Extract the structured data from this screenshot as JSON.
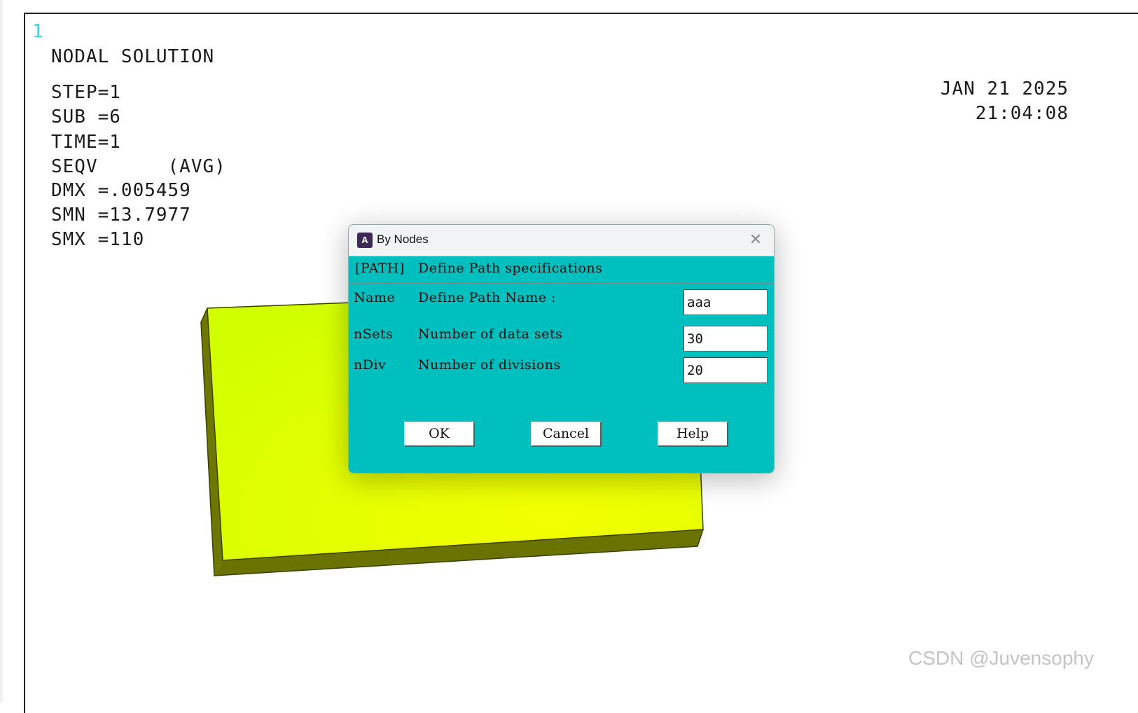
{
  "graphics": {
    "window_number": "1",
    "title": "NODAL SOLUTION",
    "info_lines": [
      "STEP=1",
      "SUB =6",
      "TIME=1",
      "SEQV      (AVG)",
      "DMX =.005459",
      "SMN =13.7977",
      "SMX =110"
    ],
    "date": "JAN 21 2025",
    "time": "21:04:08",
    "plate_color": "#dcff00",
    "plate_edge_color": "#5c6400"
  },
  "dialog": {
    "title": "By Nodes",
    "header_tag": "[PATH]",
    "header_text": "Define Path specifications",
    "background_color": "#00bfbf",
    "fields": [
      {
        "key": "Name",
        "label": "Define Path Name :",
        "value": "aaa"
      },
      {
        "key": "nSets",
        "label": "Number of data sets",
        "value": "30"
      },
      {
        "key": "nDiv",
        "label": "Number of divisions",
        "value": "20"
      }
    ],
    "buttons": {
      "ok": "OK",
      "cancel": "Cancel",
      "help": "Help"
    }
  },
  "watermark": "CSDN @Juvensophy"
}
